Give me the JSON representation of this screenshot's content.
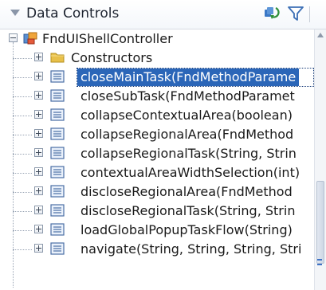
{
  "header": {
    "title": "Data Controls",
    "refresh_icon": "refresh-icon",
    "filter_icon": "filter-icon"
  },
  "tree": {
    "root": {
      "label": "FndUIShellController",
      "icon": "data-control-icon",
      "expanded": true
    },
    "children": [
      {
        "label": "Constructors",
        "icon": "folder-icon"
      },
      {
        "label": "closeMainTask(FndMethodParame",
        "icon": "method-icon",
        "selected": true
      },
      {
        "label": "closeSubTask(FndMethodParamet",
        "icon": "method-icon"
      },
      {
        "label": "collapseContextualArea(boolean)",
        "icon": "method-icon"
      },
      {
        "label": "collapseRegionalArea(FndMethod",
        "icon": "method-icon"
      },
      {
        "label": "collapseRegionalTask(String, Strin",
        "icon": "method-icon"
      },
      {
        "label": "contextualAreaWidthSelection(int)",
        "icon": "method-icon"
      },
      {
        "label": "discloseRegionalArea(FndMethod",
        "icon": "method-icon"
      },
      {
        "label": "discloseRegionalTask(String, Strin",
        "icon": "method-icon"
      },
      {
        "label": "loadGlobalPopupTaskFlow(String)",
        "icon": "method-icon"
      },
      {
        "label": "navigate(String, String, String, Stri",
        "icon": "method-icon"
      }
    ]
  },
  "colors": {
    "selection": "#2b66b8",
    "folder": "#e8c04a",
    "method_icon_border": "#4a6fa5"
  }
}
